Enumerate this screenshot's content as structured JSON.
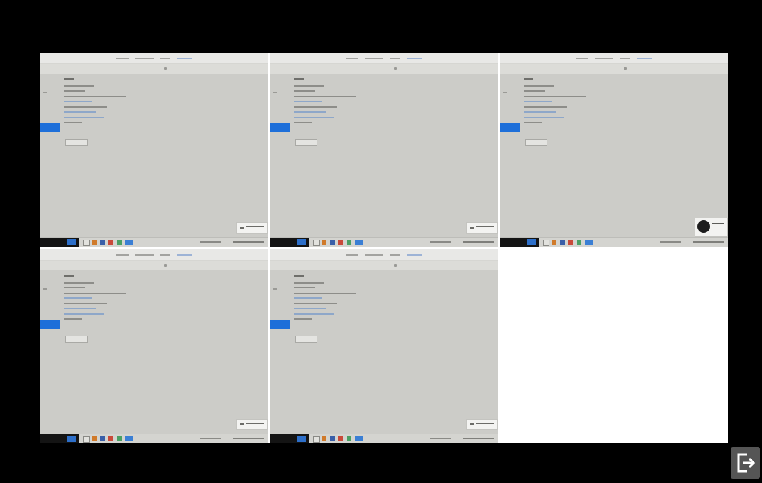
{
  "window": {
    "background_color": "#000000",
    "grid_background_color": "#ffffff"
  },
  "tiles": [
    {
      "position": "top-left",
      "state": "screen",
      "toast": "text"
    },
    {
      "position": "top-middle",
      "state": "screen",
      "toast": "text"
    },
    {
      "position": "top-right",
      "state": "screen",
      "toast": "avatar"
    },
    {
      "position": "bottom-left",
      "state": "screen",
      "toast": "text"
    },
    {
      "position": "bottom-middle",
      "state": "screen",
      "toast": "text"
    },
    {
      "position": "bottom-right",
      "state": "empty"
    }
  ],
  "colors": {
    "tile_background": "#ccccc8",
    "accent_blue": "#1e6fd9",
    "taskbar_dark": "#141414",
    "exit_button": "#555555"
  },
  "exit_button": {
    "icon": "exit-icon"
  }
}
